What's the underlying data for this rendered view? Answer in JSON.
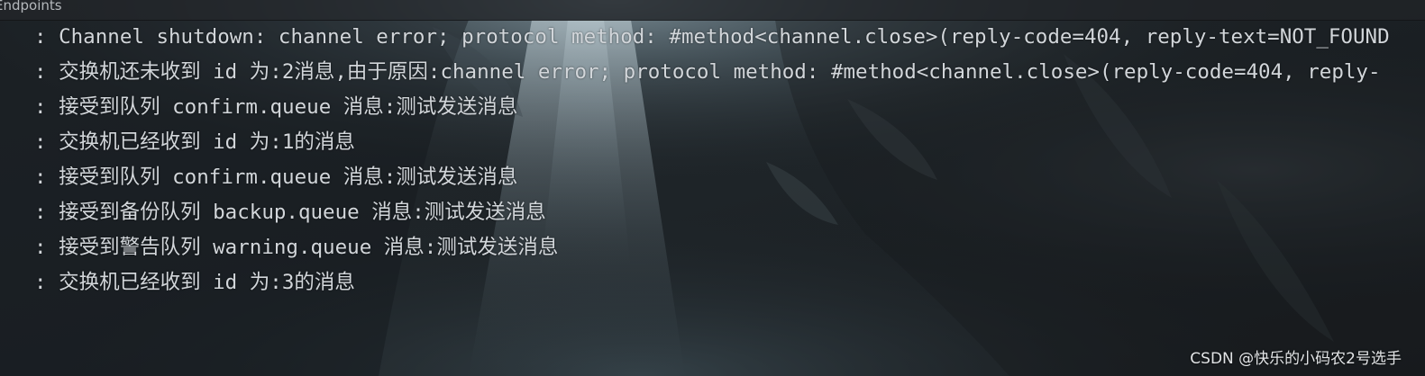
{
  "panel": {
    "tab_title": "Endpoints"
  },
  "console": {
    "lines": [
      ": Channel shutdown: channel error; protocol method: #method<channel.close>(reply-code=404, reply-text=NOT_FOUND",
      ": 交换机还未收到 id 为:2消息,由于原因:channel error; protocol method: #method<channel.close>(reply-code=404, reply-",
      ": 接受到队列 confirm.queue 消息:测试发送消息",
      ": 交换机已经收到 id 为:1的消息",
      ": 接受到队列 confirm.queue 消息:测试发送消息",
      ": 接受到备份队列 backup.queue 消息:测试发送消息",
      ": 接受到警告队列 warning.queue 消息:测试发送消息",
      ": 交换机已经收到 id 为:3的消息"
    ]
  },
  "watermark": "CSDN @快乐的小码农2号选手",
  "colors": {
    "console_text": "#d2d6da",
    "background": "#1c2024",
    "light_beam": "#a9bcc6"
  }
}
